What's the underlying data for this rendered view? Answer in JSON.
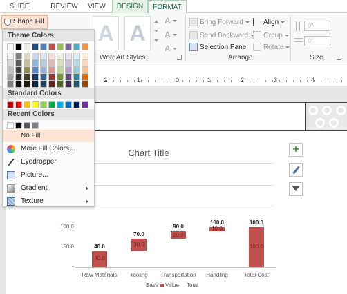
{
  "tabs": [
    {
      "label": "SLIDE SHOW",
      "state": "normal"
    },
    {
      "label": "REVIEW",
      "state": "normal"
    },
    {
      "label": "VIEW",
      "state": "normal"
    },
    {
      "label": "DESIGN",
      "state": "contextual"
    },
    {
      "label": "FORMAT",
      "state": "active"
    }
  ],
  "ribbon": {
    "shape_fill_label": "Shape Fill",
    "wordart_group_label": "WordArt Styles",
    "wordart_letter": "A",
    "arrange": {
      "bring_forward": "Bring Forward",
      "send_backward": "Send Backward",
      "selection_pane": "Selection Pane",
      "align": "Align",
      "group": "Group",
      "rotate": "Rotate",
      "group_label": "Arrange"
    },
    "size": {
      "height_value": "0\"",
      "width_value": "0\"",
      "group_label": "Size"
    }
  },
  "ruler_numbers": [
    "2",
    "1",
    "0",
    "1",
    "2",
    "3",
    "4"
  ],
  "dropdown": {
    "theme_colors_header": "Theme Colors",
    "standard_colors_header": "Standard Colors",
    "recent_colors_header": "Recent Colors",
    "theme_top_row": [
      "#ffffff",
      "#000000",
      "#eeece1",
      "#1f497d",
      "#4f81bd",
      "#c0504d",
      "#9bbb59",
      "#8064a2",
      "#4bacc6",
      "#f79646"
    ],
    "theme_shades": [
      [
        "#f2f2f2",
        "#7f7f7f",
        "#ddd9c3",
        "#c6d9f0",
        "#dbe5f1",
        "#f2dcdb",
        "#ebf1dd",
        "#e5e0ec",
        "#dbeef3",
        "#fdeada"
      ],
      [
        "#d8d8d8",
        "#595959",
        "#c4bd97",
        "#8db3e2",
        "#b8cce4",
        "#e5b9b7",
        "#d7e3bc",
        "#ccc1d9",
        "#b7dde8",
        "#fbd5b5"
      ],
      [
        "#bfbfbf",
        "#3f3f3f",
        "#938953",
        "#548dd4",
        "#95b3d7",
        "#d99694",
        "#c3d69b",
        "#b2a2c7",
        "#92cddc",
        "#fac08f"
      ],
      [
        "#a5a5a5",
        "#262626",
        "#494429",
        "#17365d",
        "#366092",
        "#953734",
        "#76923c",
        "#5f497a",
        "#31859b",
        "#e36c09"
      ],
      [
        "#7f7f7f",
        "#0c0c0c",
        "#1d1b10",
        "#0f243e",
        "#244061",
        "#632423",
        "#4f6128",
        "#3f3151",
        "#205867",
        "#974806"
      ]
    ],
    "standard_colors": [
      "#c00000",
      "#ff0000",
      "#ffc000",
      "#ffff00",
      "#92d050",
      "#00b050",
      "#00b0f0",
      "#0070c0",
      "#002060",
      "#7030a0"
    ],
    "recent_colors": [
      "#ffffff",
      "#000000",
      "#595959",
      "#7f7f7f"
    ],
    "items": [
      {
        "label": "No Fill",
        "icon": "no-fill",
        "submenu": false
      },
      {
        "label": "More Fill Colors...",
        "icon": "palette-icon",
        "submenu": false
      },
      {
        "label": "Eyedropper",
        "icon": "eyedropper-icon",
        "submenu": false
      },
      {
        "label": "Picture...",
        "icon": "picture-icon",
        "submenu": false
      },
      {
        "label": "Gradient",
        "icon": "gradient-icon",
        "submenu": true
      },
      {
        "label": "Texture",
        "icon": "texture-icon",
        "submenu": true
      }
    ]
  },
  "chart_data": {
    "type": "bar",
    "title": "Chart Title",
    "categories": [
      "Raw Materials",
      "Tooling",
      "Transportation",
      "Handling",
      "Total Cost"
    ],
    "series": [
      {
        "name": "Base",
        "values": [
          0,
          40,
          70,
          90,
          0
        ]
      },
      {
        "name": "Value",
        "values": [
          40,
          30,
          20,
          10,
          100
        ]
      },
      {
        "name": "Total",
        "values": [
          40,
          70,
          90,
          100,
          100
        ]
      }
    ],
    "data_labels_inside": [
      "40.0",
      "30.0",
      "20.0",
      "10.0",
      "100.0"
    ],
    "data_labels_top": [
      "40.0",
      "70.0",
      "90.0",
      "100.0",
      "100.0"
    ],
    "y_ticks": [
      "100.0",
      "50.0",
      "-"
    ],
    "ylim": [
      0,
      100
    ],
    "grid": true,
    "legend_position": "bottom",
    "bar_color": "#c0504d"
  }
}
